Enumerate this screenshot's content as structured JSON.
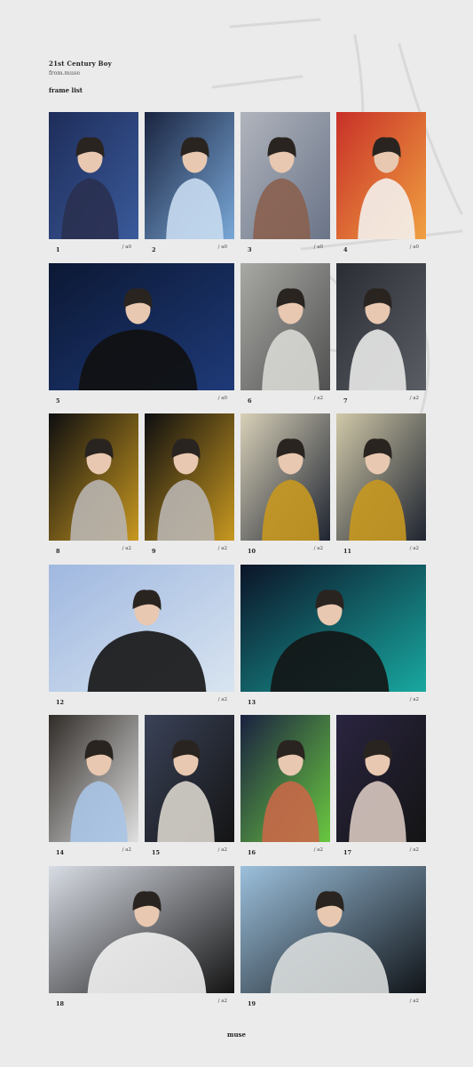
{
  "header": {
    "title": "21st Century Boy",
    "subtitle": "from.muse",
    "section_title": "frame list"
  },
  "footer": {
    "label": "muse"
  },
  "frames": [
    {
      "number": "1",
      "size": "/ a0",
      "colors": [
        "#1e2d5a",
        "#3a5a9a",
        "#2a3050"
      ]
    },
    {
      "number": "2",
      "size": "/ a0",
      "colors": [
        "#1a2440",
        "#7aa8d8",
        "#c8dcef"
      ]
    },
    {
      "number": "3",
      "size": "/ a0",
      "colors": [
        "#b0b4bc",
        "#6a7488",
        "#8a6050"
      ]
    },
    {
      "number": "4",
      "size": "/ a0",
      "colors": [
        "#c83028",
        "#f0a040",
        "#f4f0ec"
      ]
    },
    {
      "number": "5",
      "size": "/ a0",
      "colors": [
        "#0c1834",
        "#1e3a78",
        "#101010"
      ]
    },
    {
      "number": "6",
      "size": "/ a2",
      "colors": [
        "#a8a8a4",
        "#505050",
        "#d8d8d4"
      ]
    },
    {
      "number": "7",
      "size": "/ a2",
      "colors": [
        "#2a2e34",
        "#5a5e64",
        "#e8e8e8"
      ]
    },
    {
      "number": "8",
      "size": "/ a2",
      "colors": [
        "#0e0e10",
        "#c89820",
        "#b8b4b0"
      ]
    },
    {
      "number": "9",
      "size": "/ a2",
      "colors": [
        "#0e0e10",
        "#c89820",
        "#b8b4b0"
      ]
    },
    {
      "number": "10",
      "size": "/ a2",
      "colors": [
        "#d8d0b8",
        "#1e2430",
        "#c89820"
      ]
    },
    {
      "number": "11",
      "size": "/ a2",
      "colors": [
        "#d0c8a8",
        "#1e2430",
        "#c89820"
      ]
    },
    {
      "number": "12",
      "size": "/ a2",
      "colors": [
        "#a0b8e0",
        "#d8e4f0",
        "#141414"
      ]
    },
    {
      "number": "13",
      "size": "/ a2",
      "colors": [
        "#0c1428",
        "#18a8a0",
        "#141414"
      ]
    },
    {
      "number": "14",
      "size": "/ a2",
      "colors": [
        "#302c28",
        "#e0e0e0",
        "#a8c4e4"
      ]
    },
    {
      "number": "15",
      "size": "/ a2",
      "colors": [
        "#3a4258",
        "#141414",
        "#d8d4cc"
      ]
    },
    {
      "number": "16",
      "size": "/ a2",
      "colors": [
        "#1a2040",
        "#6ac840",
        "#c86848"
      ]
    },
    {
      "number": "17",
      "size": "/ a2",
      "colors": [
        "#2a2440",
        "#141414",
        "#d8c8c0"
      ]
    },
    {
      "number": "18",
      "size": "/ a2",
      "colors": [
        "#d8dce4",
        "#141414",
        "#f0f0f0"
      ]
    },
    {
      "number": "19",
      "size": "/ a2",
      "colors": [
        "#9cc0dc",
        "#101418",
        "#d8dcdc"
      ]
    }
  ]
}
